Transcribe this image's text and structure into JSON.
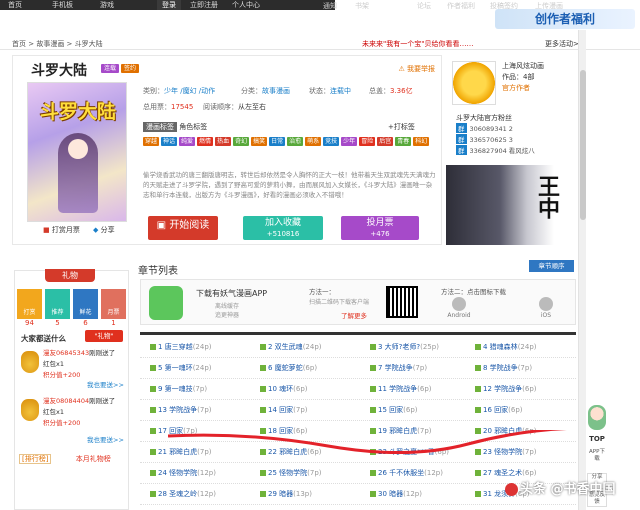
{
  "topbar": {
    "home": "首页",
    "mobile": "手机板",
    "game": "游戏",
    "login": "登录",
    "register": "立即注册",
    "user_center": "个人中心"
  },
  "banner": {
    "links": [
      "通知",
      "书架",
      "论坛",
      "作者福利",
      "投稿签约",
      "上传漫画"
    ],
    "ad_text": "创作者福利"
  },
  "breadcrumb": {
    "home": "首页",
    "category": "故事漫画",
    "current": "斗罗大陆"
  },
  "news": {
    "text": "未来来\"我有一个宝\"贝给你看看……",
    "more": "更多活动>>"
  },
  "comic": {
    "title": "斗罗大陆",
    "badge1": "连载",
    "badge2": "签约",
    "report": "我要举报",
    "genre_label": "类别：",
    "genre": "少年 /魔幻 /动作",
    "cat_label": "分类：",
    "category": "故事漫画",
    "status_label": "状态：",
    "status": "连载中",
    "score_label": "总盖：",
    "score": "3.36亿",
    "pages_label": "总用票：",
    "pages": "17545",
    "order_label": "阅读顺序：",
    "order": "从左至右",
    "tag_btn": "漫画标签",
    "tag_label": "角色标签",
    "add_tag": "+打标签",
    "tags": [
      "穿越",
      "神话",
      "纯爱",
      "燃情",
      "热血",
      "奇幻",
      "搞笑",
      "日常",
      "治愈",
      "萌系",
      "竞技",
      "少年",
      "冒险",
      "后宫",
      "青春",
      "科幻"
    ],
    "tag_colors": [
      "#e07000",
      "#1a7fc9",
      "#a64ac9",
      "#e0301e",
      "#d43a2a",
      "#58a83a",
      "#e07000",
      "#1a7fc9",
      "#58a83a",
      "#e07000",
      "#1a7fc9",
      "#a64ac9",
      "#e0301e",
      "#d43a2a",
      "#58a83a",
      "#e07000"
    ],
    "description": "偷学烧香武功的唐三翻版唐明志，转世后却依然是令人胸怀的正大一枝！他带着天生双武魂先天满魂力的天赋走进了斗罗学院，遇到了野高可爱的萝莉小舞，由而展风加入女媒长，《斗罗大陆》漫画唯一杂志和单行本连载，出版方为《斗罗漫画》，好看的漫画必须收入不错哦！",
    "read_btn": "开始阅读",
    "fav_btn": "加入收藏",
    "fav_count": "+510816",
    "vote_btn": "投月票",
    "vote_count": "+476",
    "tip": "打赏月票",
    "share": "分享"
  },
  "author": {
    "name": "上海风炫动画",
    "works_label": "作品：",
    "works": "4部",
    "badge": "官方作者",
    "list_title": "斗罗大陆官方粉丝",
    "groups": [
      {
        "tag": "群",
        "no": "306089341 2"
      },
      {
        "tag": "群",
        "no": "336570625 3"
      },
      {
        "tag": "群",
        "no": "336827904 看风炫八"
      }
    ]
  },
  "sidepic": {
    "text": "王中"
  },
  "gift": {
    "head": "礼物",
    "items": [
      {
        "label": "打赏",
        "count": "94"
      },
      {
        "label": "推荐",
        "count": "5"
      },
      {
        "label": "鲜花",
        "count": "6"
      },
      {
        "label": "月票",
        "count": "1"
      }
    ],
    "ask": "大家都送什么",
    "ask_btn": "\"礼物\"",
    "donors": [
      {
        "user": "漫友06845343",
        "action": "刚刚送了",
        "gift": "红包x1",
        "exp": "积分值+200"
      },
      {
        "user": "漫友08084404",
        "action": "刚刚送了",
        "gift": "红包x1",
        "exp": "积分值+200"
      }
    ],
    "more": "我也要送>>",
    "rank_l": "[排行榜]",
    "rank_r": "本月礼物榜"
  },
  "chapters": {
    "title": "章节列表",
    "order_btn": "章节顺序",
    "app_title": "下载有妖气漫画APP",
    "app_sub1": "离线缓存",
    "app_sub2": "追更神器",
    "m1_title": "方法一：",
    "m1_text": "扫描二维码下载客户端",
    "m1_more": "了解更多",
    "m2_title": "方法二：点击图标下载",
    "android": "Android",
    "ios": "iOS",
    "rows": [
      [
        {
          "t": "1 唐三穿越",
          "p": "(24p)"
        },
        {
          "t": "2 双生武魂",
          "p": "(24p)"
        },
        {
          "t": "3 大师?老师?",
          "p": "(25p)"
        },
        {
          "t": "4 猎魂森林",
          "p": "(24p)"
        }
      ],
      [
        {
          "t": "5 第一魂环",
          "p": "(24p)"
        },
        {
          "t": "6 魔蛇萝蛇",
          "p": "(6p)"
        },
        {
          "t": "7 学院战争",
          "p": "(7p)"
        },
        {
          "t": "8 学院战争",
          "p": "(7p)"
        }
      ],
      [
        {
          "t": "9 第一魂技",
          "p": "(7p)"
        },
        {
          "t": "10 魂环",
          "p": "(6p)"
        },
        {
          "t": "11 学院战争",
          "p": "(6p)"
        },
        {
          "t": "12 学院战争",
          "p": "(6p)"
        }
      ],
      [
        {
          "t": "13 学院战争",
          "p": "(7p)"
        },
        {
          "t": "14 回家",
          "p": "(7p)"
        },
        {
          "t": "15 回家",
          "p": "(6p)"
        },
        {
          "t": "16 回家",
          "p": "(6p)"
        }
      ],
      [
        {
          "t": "17 回家",
          "p": "(7p)"
        },
        {
          "t": "18 回家",
          "p": "(6p)"
        },
        {
          "t": "19 邪眸白虎",
          "p": "(7p)"
        },
        {
          "t": "20 邪眸白虎",
          "p": "(6p)"
        }
      ],
      [
        {
          "t": "21 邪眸白虎",
          "p": "(7p)"
        },
        {
          "t": "22 邪眸白虎",
          "p": "(6p)"
        },
        {
          "t": "23 斗罗之夏***香",
          "p": "(6p)"
        },
        {
          "t": "23 怪物学院",
          "p": "(7p)"
        }
      ],
      [
        {
          "t": "24 怪物学院",
          "p": "(12p)"
        },
        {
          "t": "25 怪物学院",
          "p": "(7p)"
        },
        {
          "t": "26 千不休服坐",
          "p": "(12p)"
        },
        {
          "t": "27 魂圣之术",
          "p": "(6p)"
        }
      ],
      [
        {
          "t": "28 圣魂之岭",
          "p": "(12p)"
        },
        {
          "t": "29 暗器",
          "p": "(13p)"
        },
        {
          "t": "30 暗器",
          "p": "(12p)"
        },
        {
          "t": "31 龙须针",
          "p": "(6p)"
        }
      ]
    ]
  },
  "fab": {
    "top": "TOP",
    "app": "APP下载",
    "share": "分享",
    "feedback": "意见反馈"
  },
  "watermark": "头条 @书香中国"
}
